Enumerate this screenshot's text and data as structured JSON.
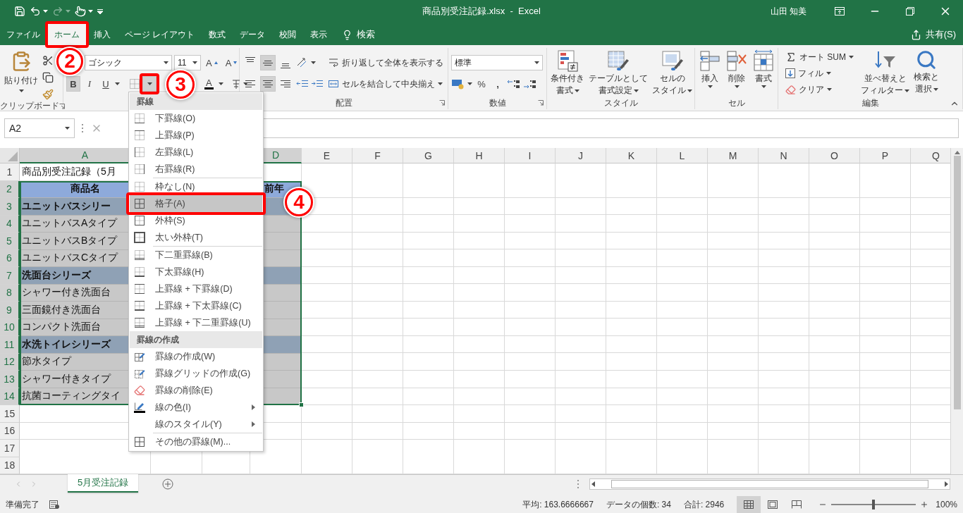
{
  "window": {
    "title": "商品別受注記録.xlsx  -  Excel",
    "user": "山田 知美"
  },
  "quick_access": {
    "redo": {
      "disabled": true
    }
  },
  "ribbon_tabs": [
    {
      "label": "ファイル",
      "selected": false
    },
    {
      "label": "ホーム",
      "selected": true
    },
    {
      "label": "挿入",
      "selected": false
    },
    {
      "label": "ページ レイアウト",
      "selected": false
    },
    {
      "label": "数式",
      "selected": false
    },
    {
      "label": "データ",
      "selected": false
    },
    {
      "label": "校閲",
      "selected": false
    },
    {
      "label": "表示",
      "selected": false
    }
  ],
  "tell_me": "検索",
  "share": "共有(S)",
  "clipboard": {
    "paste": "貼り付け",
    "group_label": "クリップボード"
  },
  "font": {
    "name": "ゴシック",
    "size": "11",
    "grow": "A",
    "shrink": "A",
    "bold": {
      "label": "B",
      "selected": true
    },
    "italic": "I",
    "underline": "U",
    "font_color": "A"
  },
  "alignment": {
    "vertical": [
      {
        "selected": false
      },
      {
        "selected": true
      },
      {
        "selected": false
      }
    ],
    "horizontal": [
      {
        "selected": false
      },
      {
        "selected": true
      },
      {
        "selected": false
      }
    ],
    "wrap": "折り返して全体を表示する",
    "merge": "セルを結合して中央揃え",
    "group_label": "配置"
  },
  "number": {
    "format": "標準",
    "percent": "%",
    "comma": ",",
    "group_label": "数値"
  },
  "styles": {
    "buttons": [
      {
        "lines": [
          "条件付き",
          "書式"
        ]
      },
      {
        "lines": [
          "テーブルとして",
          "書式設定"
        ]
      },
      {
        "lines": [
          "セルの",
          "スタイル"
        ]
      }
    ],
    "group_label": "スタイル"
  },
  "cells": {
    "buttons": [
      {
        "lines": [
          "挿入"
        ]
      },
      {
        "lines": [
          "削除"
        ]
      },
      {
        "lines": [
          "書式"
        ]
      }
    ],
    "group_label": "セル"
  },
  "editing": {
    "autosum": "オート SUM",
    "fill": "フィル",
    "clear": "クリア",
    "buttons": [
      {
        "lines": [
          "並べ替えと",
          "フィルター"
        ]
      },
      {
        "lines": [
          "検索と",
          "選択"
        ]
      }
    ],
    "group_label": "編集"
  },
  "formula_bar": {
    "name_box": "A2"
  },
  "sheet": {
    "columns": [
      {
        "label": "A",
        "selected": true
      },
      {
        "label": "D",
        "selected": true
      },
      {
        "label": "E",
        "selected": false
      },
      {
        "label": "F",
        "selected": false
      },
      {
        "label": "G",
        "selected": false
      },
      {
        "label": "H",
        "selected": false
      },
      {
        "label": "I",
        "selected": false
      },
      {
        "label": "J",
        "selected": false
      },
      {
        "label": "K",
        "selected": false
      },
      {
        "label": "L",
        "selected": false
      },
      {
        "label": "M",
        "selected": false
      },
      {
        "label": "N",
        "selected": false
      },
      {
        "label": "O",
        "selected": false
      },
      {
        "label": "P",
        "selected": false
      },
      {
        "label": "Q",
        "selected": false
      }
    ],
    "rows": [
      {
        "number": "1",
        "selected": false,
        "kind": "title",
        "a": "商品別受注記録（5月"
      },
      {
        "number": "2",
        "selected": true,
        "kind": "header",
        "a": "商品名",
        "d": "前年"
      },
      {
        "number": "3",
        "selected": true,
        "kind": "group",
        "a": "ユニットバスシリー"
      },
      {
        "number": "4",
        "selected": true,
        "kind": "item",
        "a": "ユニットバスAタイプ"
      },
      {
        "number": "5",
        "selected": true,
        "kind": "item",
        "a": "ユニットバスBタイプ"
      },
      {
        "number": "6",
        "selected": true,
        "kind": "item",
        "a": "ユニットバスCタイプ"
      },
      {
        "number": "7",
        "selected": true,
        "kind": "group",
        "a": "洗面台シリーズ"
      },
      {
        "number": "8",
        "selected": true,
        "kind": "item",
        "a": "シャワー付き洗面台"
      },
      {
        "number": "9",
        "selected": true,
        "kind": "item",
        "a": "三面鏡付き洗面台"
      },
      {
        "number": "10",
        "selected": true,
        "kind": "item",
        "a": "コンパクト洗面台"
      },
      {
        "number": "11",
        "selected": true,
        "kind": "group",
        "a": "水洗トイレシリーズ"
      },
      {
        "number": "12",
        "selected": true,
        "kind": "item",
        "a": "節水タイプ"
      },
      {
        "number": "13",
        "selected": true,
        "kind": "item",
        "a": "シャワー付きタイプ"
      },
      {
        "number": "14",
        "selected": true,
        "kind": "item",
        "a": "抗菌コーティングタイ"
      },
      {
        "number": "15",
        "selected": false,
        "kind": "blank"
      },
      {
        "number": "16",
        "selected": false,
        "kind": "blank"
      },
      {
        "number": "17",
        "selected": false,
        "kind": "blank"
      },
      {
        "number": "18",
        "selected": false,
        "kind": "blank"
      }
    ]
  },
  "border_menu": {
    "open": true,
    "sections": [
      {
        "title": "罫線",
        "items": [
          {
            "label": "下罫線(O)",
            "selected": false,
            "separator_before": false,
            "submenu": false
          },
          {
            "label": "上罫線(P)",
            "selected": false,
            "separator_before": false,
            "submenu": false
          },
          {
            "label": "左罫線(L)",
            "selected": false,
            "separator_before": false,
            "submenu": false
          },
          {
            "label": "右罫線(R)",
            "selected": false,
            "separator_before": false,
            "submenu": false
          },
          {
            "label": "枠なし(N)",
            "selected": false,
            "separator_before": true,
            "submenu": false
          },
          {
            "label": "格子(A)",
            "selected": true,
            "separator_before": false,
            "submenu": false
          },
          {
            "label": "外枠(S)",
            "selected": false,
            "separator_before": false,
            "submenu": false
          },
          {
            "label": "太い外枠(T)",
            "selected": false,
            "separator_before": false,
            "submenu": false
          },
          {
            "label": "下二重罫線(B)",
            "selected": false,
            "separator_before": true,
            "submenu": false
          },
          {
            "label": "下太罫線(H)",
            "selected": false,
            "separator_before": false,
            "submenu": false
          },
          {
            "label": "上罫線 + 下罫線(D)",
            "selected": false,
            "separator_before": false,
            "submenu": false
          },
          {
            "label": "上罫線 + 下太罫線(C)",
            "selected": false,
            "separator_before": false,
            "submenu": false
          },
          {
            "label": "上罫線 + 下二重罫線(U)",
            "selected": false,
            "separator_before": false,
            "submenu": false
          }
        ]
      },
      {
        "title": "罫線の作成",
        "items": [
          {
            "label": "罫線の作成(W)",
            "selected": false,
            "separator_before": false,
            "submenu": false
          },
          {
            "label": "罫線グリッドの作成(G)",
            "selected": false,
            "separator_before": false,
            "submenu": false
          },
          {
            "label": "罫線の削除(E)",
            "selected": false,
            "separator_before": false,
            "submenu": false
          },
          {
            "label": "線の色(I)",
            "selected": false,
            "separator_before": false,
            "submenu": true
          },
          {
            "label": "線のスタイル(Y)",
            "selected": false,
            "separator_before": false,
            "submenu": true
          },
          {
            "label": "その他の罫線(M)...",
            "selected": false,
            "separator_before": true,
            "submenu": false
          }
        ]
      }
    ]
  },
  "sheet_tabs": [
    {
      "label": "5月受注記録",
      "selected": true
    }
  ],
  "status_bar": {
    "mode": "準備完了",
    "stats": [
      "平均: 163.6666667",
      "データの個数: 34",
      "合計: 2946"
    ],
    "views": [
      {
        "kind": "normal",
        "selected": true
      },
      {
        "kind": "page-layout",
        "selected": false
      },
      {
        "kind": "page-break",
        "selected": false
      }
    ],
    "zoom": {
      "level": 0.5,
      "reading": "100%"
    }
  },
  "annotations": [
    {
      "label": "2"
    },
    {
      "label": "3"
    },
    {
      "label": "4"
    }
  ]
}
